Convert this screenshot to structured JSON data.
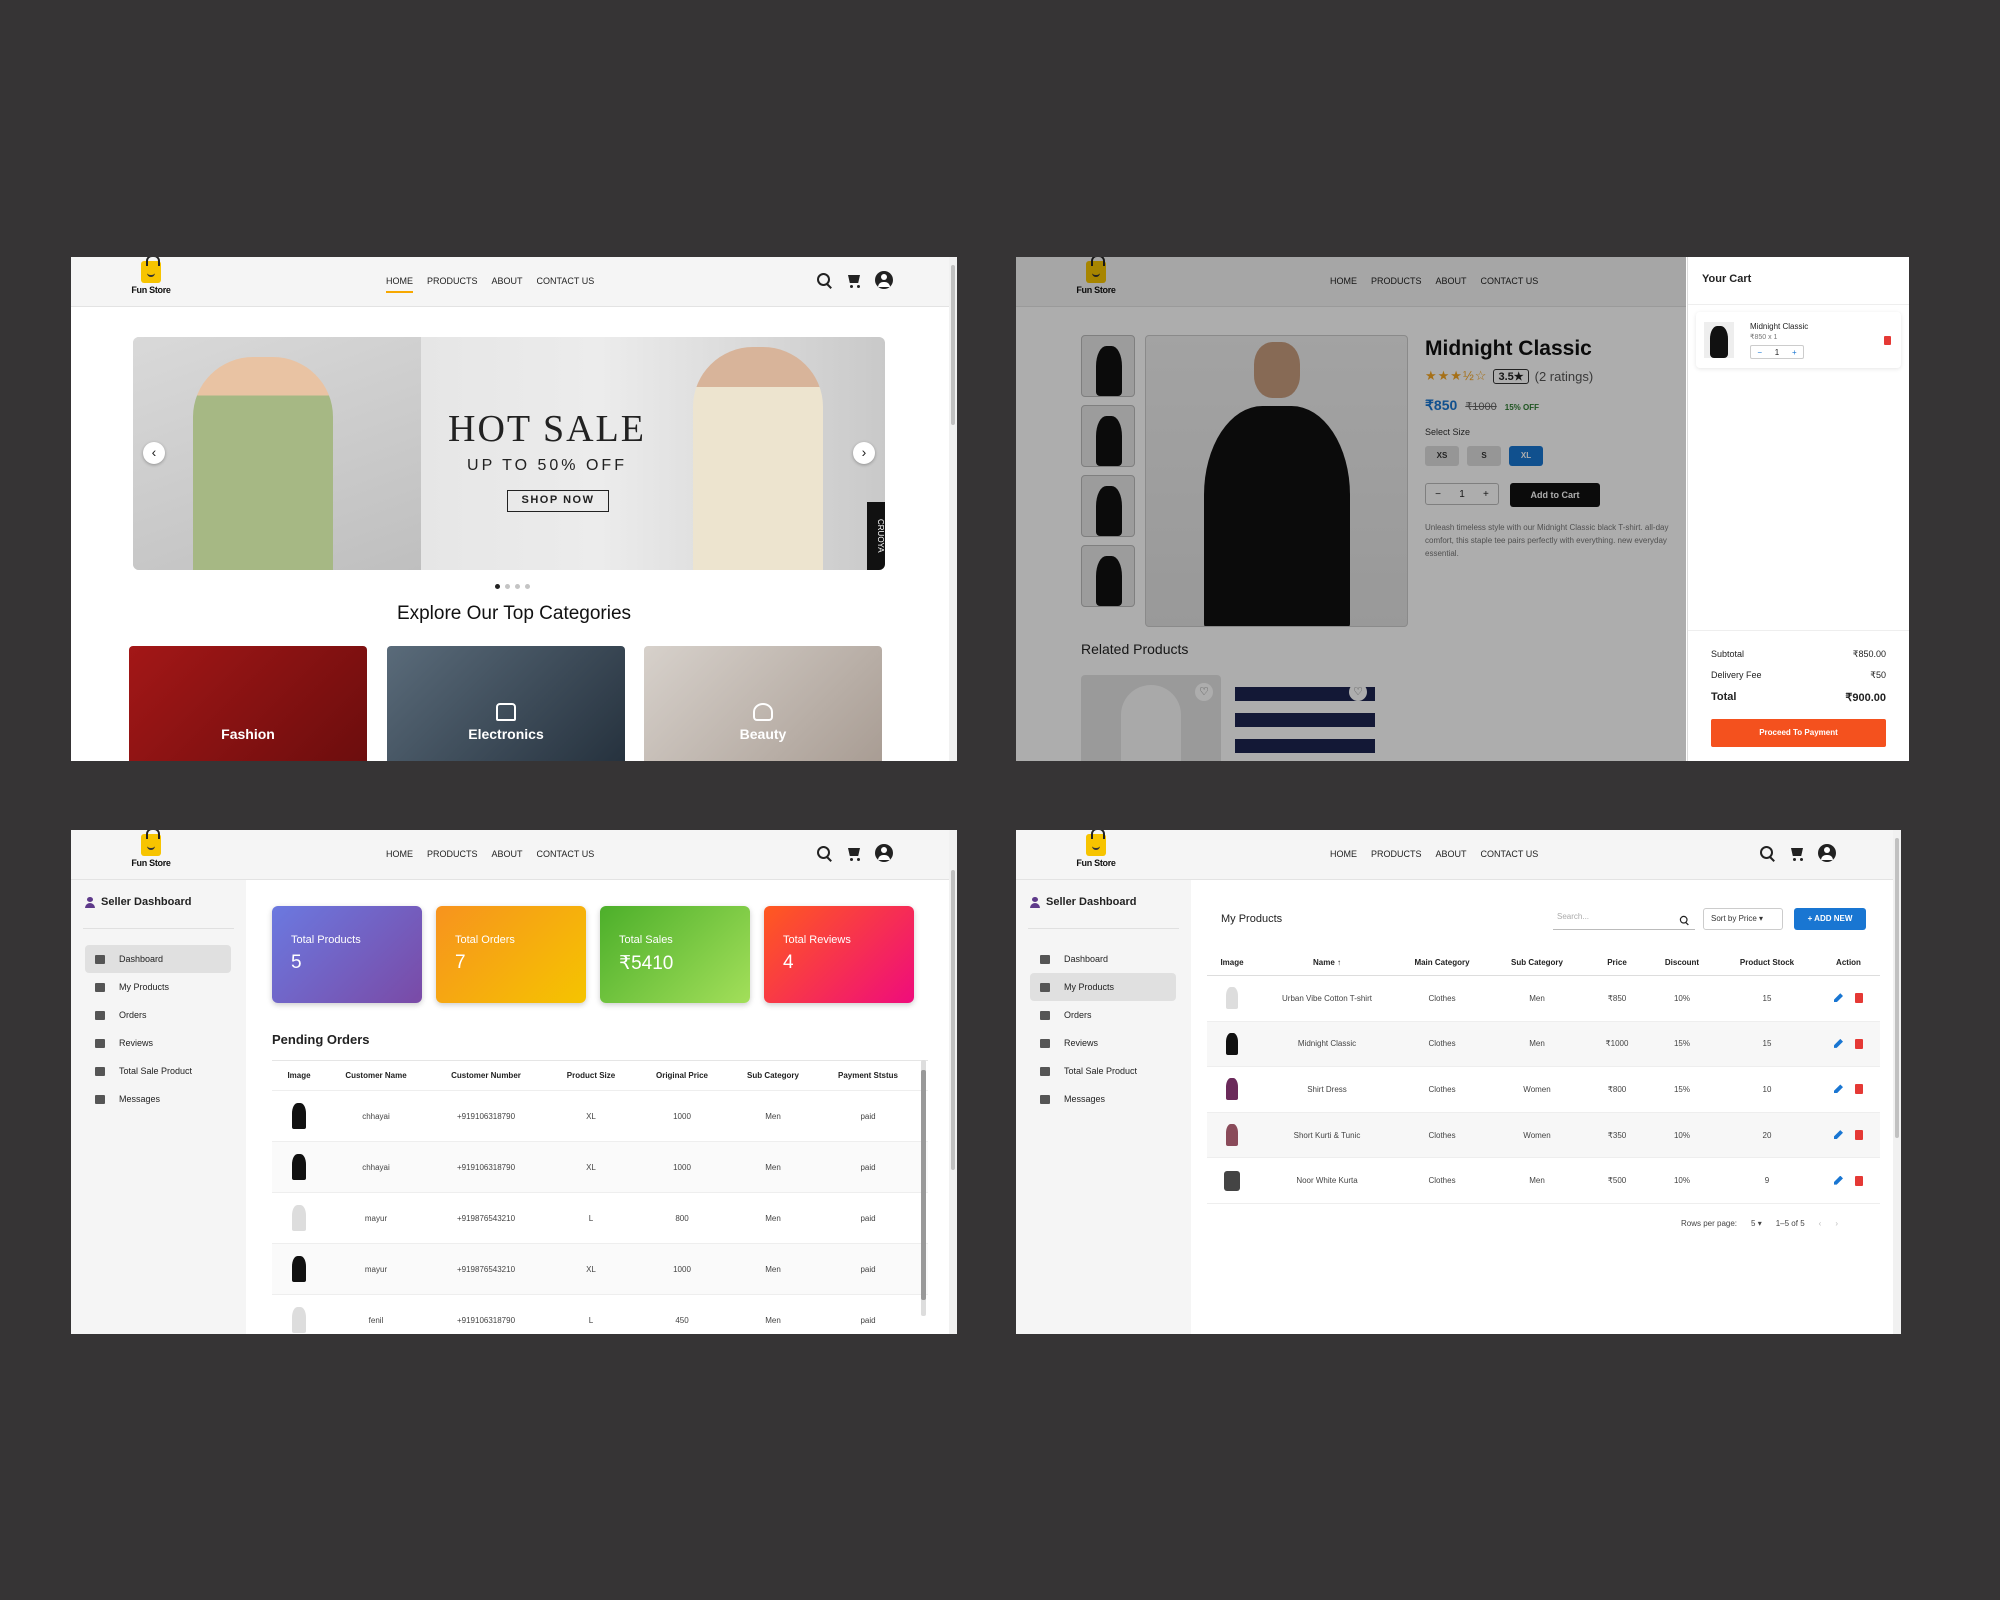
{
  "brand": {
    "name": "Fun Store",
    "accent": "#f7c400"
  },
  "nav": {
    "items": [
      "HOME",
      "PRODUCTS",
      "ABOUT",
      "CONTACT US"
    ],
    "icons": [
      "search-icon",
      "cart-icon",
      "account-icon"
    ]
  },
  "home": {
    "banner": {
      "headline": "HOT SALE",
      "subline": "UP TO 50% OFF",
      "cta": "SHOP NOW",
      "side_tag": "CRUOYA"
    },
    "section_title": "Explore Our Top Categories",
    "categories": [
      {
        "label": "Fashion",
        "color": "#9e1414"
      },
      {
        "label": "Electronics",
        "color": "#3d4c5a"
      },
      {
        "label": "Beauty",
        "color": "#c9c3bd"
      }
    ]
  },
  "product": {
    "name": "Midnight Classic",
    "rating": "3.5★",
    "rating_count": "(2 ratings)",
    "price": "₹850",
    "old_price": "₹1000",
    "discount": "15% OFF",
    "select_size": "Select Size",
    "sizes": [
      "XS",
      "S",
      "XL"
    ],
    "qty": "1",
    "add_to_cart": "Add to Cart",
    "description": "Unleash timeless style with our Midnight Classic black T-shirt. all-day comfort, this staple tee pairs perfectly with everything. new everyday essential.",
    "related_title": "Related Products"
  },
  "cart": {
    "title": "Your Cart",
    "item": {
      "name": "Midnight Classic",
      "price_qty": "₹850 x 1",
      "qty": "1"
    },
    "subtotal_label": "Subtotal",
    "subtotal": "₹850.00",
    "delivery_label": "Delivery Fee",
    "delivery": "₹50",
    "total_label": "Total",
    "total": "₹900.00",
    "checkout": "Proceed To Payment"
  },
  "seller": {
    "title": "Seller Dashboard",
    "menu": [
      "Dashboard",
      "My Products",
      "Orders",
      "Reviews",
      "Total Sale Product",
      "Messages"
    ],
    "stats": [
      {
        "label": "Total Products",
        "value": "5"
      },
      {
        "label": "Total Orders",
        "value": "7"
      },
      {
        "label": "Total Sales",
        "value": "₹5410"
      },
      {
        "label": "Total Reviews",
        "value": "4"
      }
    ],
    "pending_title": "Pending Orders",
    "pending_headers": [
      "Image",
      "Customer Name",
      "Customer Number",
      "Product Size",
      "Original Price",
      "Sub Category",
      "Payment Ststus"
    ],
    "pending_rows": [
      [
        "chhayai",
        "+919106318790",
        "XL",
        "1000",
        "Men",
        "paid"
      ],
      [
        "chhayai",
        "+919106318790",
        "XL",
        "1000",
        "Men",
        "paid"
      ],
      [
        "mayur",
        "+919876543210",
        "L",
        "800",
        "Men",
        "paid"
      ],
      [
        "mayur",
        "+919876543210",
        "XL",
        "1000",
        "Men",
        "paid"
      ],
      [
        "fenil",
        "+919106318790",
        "L",
        "450",
        "Men",
        "paid"
      ]
    ]
  },
  "products_page": {
    "title": "My Products",
    "search_placeholder": "Search...",
    "sort": "Sort by Price",
    "add_new": "+ ADD NEW",
    "headers": [
      "Image",
      "Name ↑",
      "Main Category",
      "Sub Category",
      "Price",
      "Discount",
      "Product Stock",
      "Action"
    ],
    "rows": [
      [
        "Urban Vibe Cotton T-shirt",
        "Clothes",
        "Men",
        "₹850",
        "10%",
        "15"
      ],
      [
        "Midnight Classic",
        "Clothes",
        "Men",
        "₹1000",
        "15%",
        "15"
      ],
      [
        "Shirt Dress",
        "Clothes",
        "Women",
        "₹800",
        "15%",
        "10"
      ],
      [
        "Short Kurti & Tunic",
        "Clothes",
        "Women",
        "₹350",
        "10%",
        "20"
      ],
      [
        "Noor White Kurta",
        "Clothes",
        "Men",
        "₹500",
        "10%",
        "9"
      ]
    ],
    "rows_per_page_label": "Rows per page:",
    "rows_per_page": "5",
    "range": "1–5 of 5"
  }
}
